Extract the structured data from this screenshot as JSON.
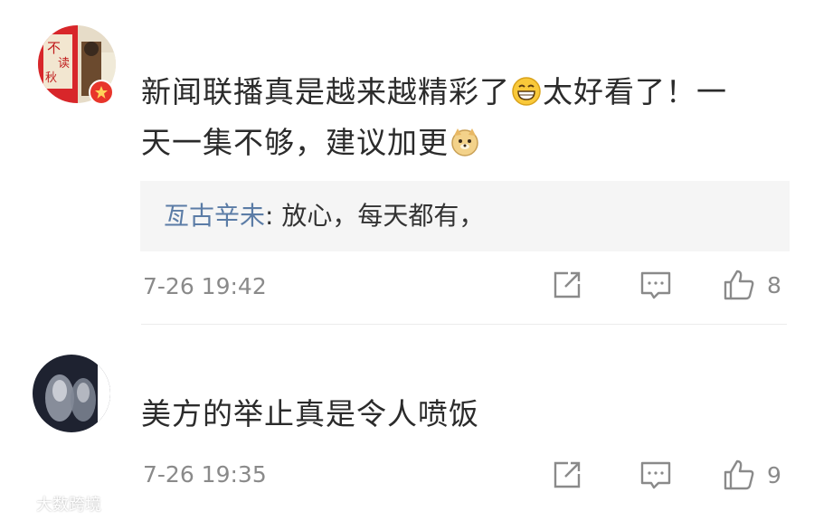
{
  "comments": [
    {
      "text_part1": "新闻联播真是越来越精彩了",
      "emoji1": "grin-emoji",
      "text_part2": "太好看了！一天一集不够，建议加更",
      "emoji2": "doge-emoji",
      "reply": {
        "author": "亙古辛未",
        "text": ": 放心，每天都有，"
      },
      "timestamp": "7-26 19:42",
      "likes": "8"
    },
    {
      "text": "美方的举止真是令人喷饭",
      "timestamp": "7-26 19:35",
      "likes": "9"
    }
  ],
  "watermark": "大数跨境",
  "icons": [
    "share-icon",
    "comment-icon",
    "like-icon"
  ],
  "colors": {
    "reply_author": "#5b7ca6",
    "meta": "#8a8a8a",
    "badge": "#e8352b"
  }
}
